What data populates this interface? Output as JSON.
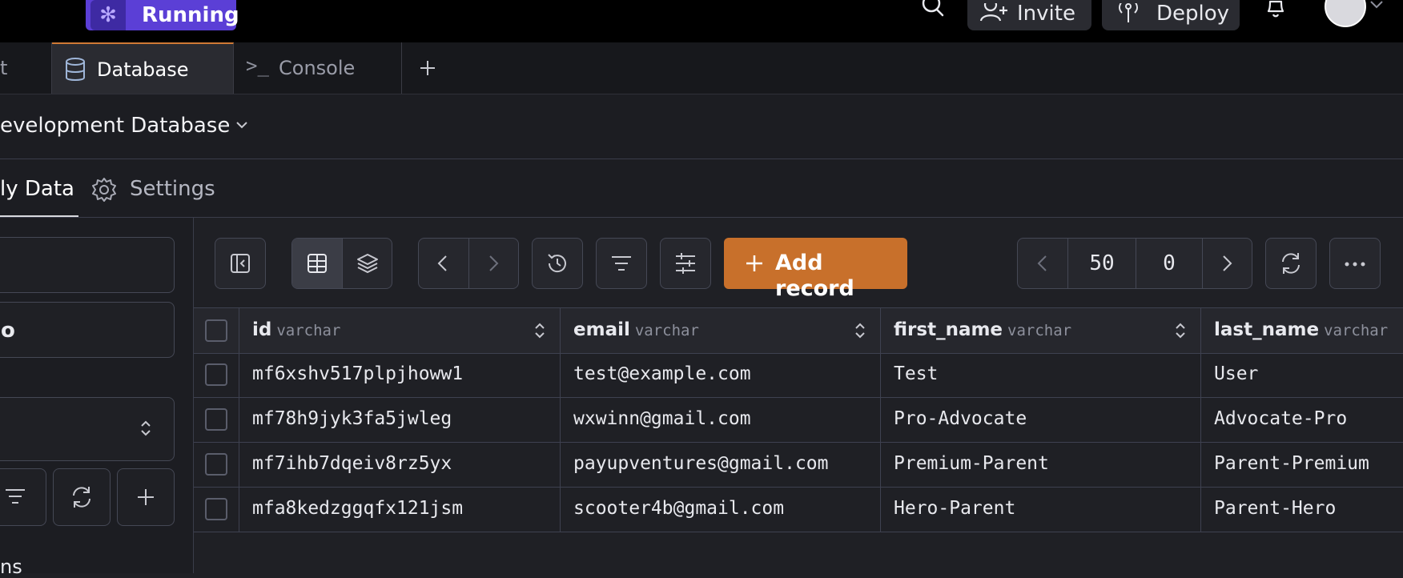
{
  "topbar": {
    "status_label": "Running",
    "invite_label": "Invite",
    "deploy_label": "Deploy"
  },
  "tabs": [
    {
      "label": "t"
    },
    {
      "label": "Database"
    },
    {
      "label": "Console"
    }
  ],
  "database": {
    "title": "evelopment Database"
  },
  "subtabs": [
    {
      "label": "ly Data"
    },
    {
      "label": "Settings"
    }
  ],
  "sidebar": {
    "select_text": "o",
    "bottom_text": "ns"
  },
  "toolbar": {
    "add_record_label": "Add record",
    "page_limit": "50",
    "page_offset": "0"
  },
  "table": {
    "columns": [
      {
        "name": "id",
        "type": "varchar"
      },
      {
        "name": "email",
        "type": "varchar"
      },
      {
        "name": "first_name",
        "type": "varchar"
      },
      {
        "name": "last_name",
        "type": "varchar"
      }
    ],
    "rows": [
      [
        "mf6xshv517plpjhoww1",
        "test@example.com",
        "Test",
        "User"
      ],
      [
        "mf78h9jyk3fa5jwleg",
        "wxwinn@gmail.com",
        "Pro-Advocate",
        "Advocate-Pro"
      ],
      [
        "mf7ihb7dqeiv8rz5yx",
        "payupventures@gmail.com",
        "Premium-Parent",
        "Parent-Premium"
      ],
      [
        "mfa8kedzggqfx121jsm",
        "scooter4b@gmail.com",
        "Hero-Parent",
        "Parent-Hero"
      ]
    ]
  },
  "colors": {
    "accent_running": "#5b3fd6",
    "add_record": "#c8702b",
    "background": "#1f2025"
  }
}
